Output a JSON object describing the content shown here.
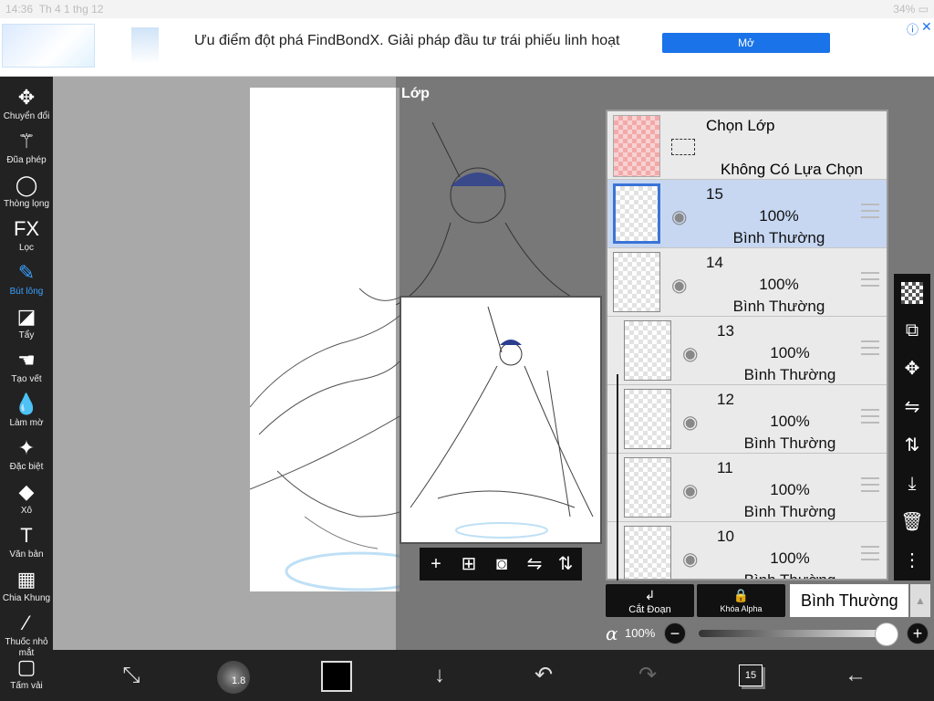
{
  "status": {
    "time": "14:36",
    "date": "Th 4 1 thg 12",
    "battery": "34%"
  },
  "ad": {
    "headline": "Ưu điểm đột phá FindBondX. Giải pháp đầu tư trái phiếu linh hoạt",
    "button": "Mở",
    "info_icon": "info-icon",
    "close_icon": "close-icon"
  },
  "tools": [
    {
      "label": "Chuyển đổi",
      "icon": "move-icon",
      "glyph": "✥"
    },
    {
      "label": "Đũa phép",
      "icon": "magic-wand-icon",
      "glyph": "⚚"
    },
    {
      "label": "Thòng lọng",
      "icon": "lasso-icon",
      "glyph": "◯"
    },
    {
      "label": "Lọc",
      "icon": "fx-icon",
      "glyph": "FX"
    },
    {
      "label": "Bút lông",
      "icon": "brush-icon",
      "glyph": "✎",
      "active": true
    },
    {
      "label": "Tẩy",
      "icon": "eraser-icon",
      "glyph": "◪"
    },
    {
      "label": "Tạo vết",
      "icon": "smudge-icon",
      "glyph": "☚"
    },
    {
      "label": "Làm mờ",
      "icon": "blur-icon",
      "glyph": "💧"
    },
    {
      "label": "Đặc biệt",
      "icon": "special-icon",
      "glyph": "✦"
    },
    {
      "label": "Xô",
      "icon": "bucket-icon",
      "glyph": "◆"
    },
    {
      "label": "Văn bản",
      "icon": "text-icon",
      "glyph": "T"
    },
    {
      "label": "Chia Khung",
      "icon": "frame-divider-icon",
      "glyph": "▦"
    },
    {
      "label": "Thuốc nhỏ mắt",
      "icon": "eyedropper-icon",
      "glyph": "⁄"
    },
    {
      "label": "Tấm vải",
      "icon": "canvas-icon",
      "glyph": "▢"
    }
  ],
  "panel": {
    "title": "Lớp"
  },
  "selection_layer": {
    "title": "Chọn Lớp",
    "state": "Không Có Lựa Chọn"
  },
  "layers": [
    {
      "name": "15",
      "opacity": "100%",
      "mode": "Bình Thường",
      "selected": true,
      "clipped": false
    },
    {
      "name": "14",
      "opacity": "100%",
      "mode": "Bình Thường",
      "selected": false,
      "clipped": false
    },
    {
      "name": "13",
      "opacity": "100%",
      "mode": "Bình Thường",
      "selected": false,
      "clipped": true
    },
    {
      "name": "12",
      "opacity": "100%",
      "mode": "Bình Thường",
      "selected": false,
      "clipped": true
    },
    {
      "name": "11",
      "opacity": "100%",
      "mode": "Bình Thường",
      "selected": false,
      "clipped": true
    },
    {
      "name": "10",
      "opacity": "100%",
      "mode": "Bình Thường",
      "selected": false,
      "clipped": true
    }
  ],
  "layer_actions": {
    "clip_label": "Cắt Đoạn",
    "alpha_lock_label": "Khóa Alpha",
    "blend_mode": "Bình Thường"
  },
  "opacity": {
    "symbol": "α",
    "value": "100%",
    "level": 1.0
  },
  "preview_tools": [
    "add-layer-icon",
    "add-image-layer-icon",
    "camera-icon",
    "flip-horizontal-icon",
    "flip-vertical-icon"
  ],
  "right_tools": [
    "transparency-icon",
    "layer-transform-icon",
    "move-layer-icon",
    "flip-h-icon",
    "flip-v-icon",
    "merge-down-icon",
    "delete-icon",
    "more-icon"
  ],
  "bottom": {
    "brush_size": "1.8",
    "color": "#000000",
    "layer_count": "15"
  }
}
